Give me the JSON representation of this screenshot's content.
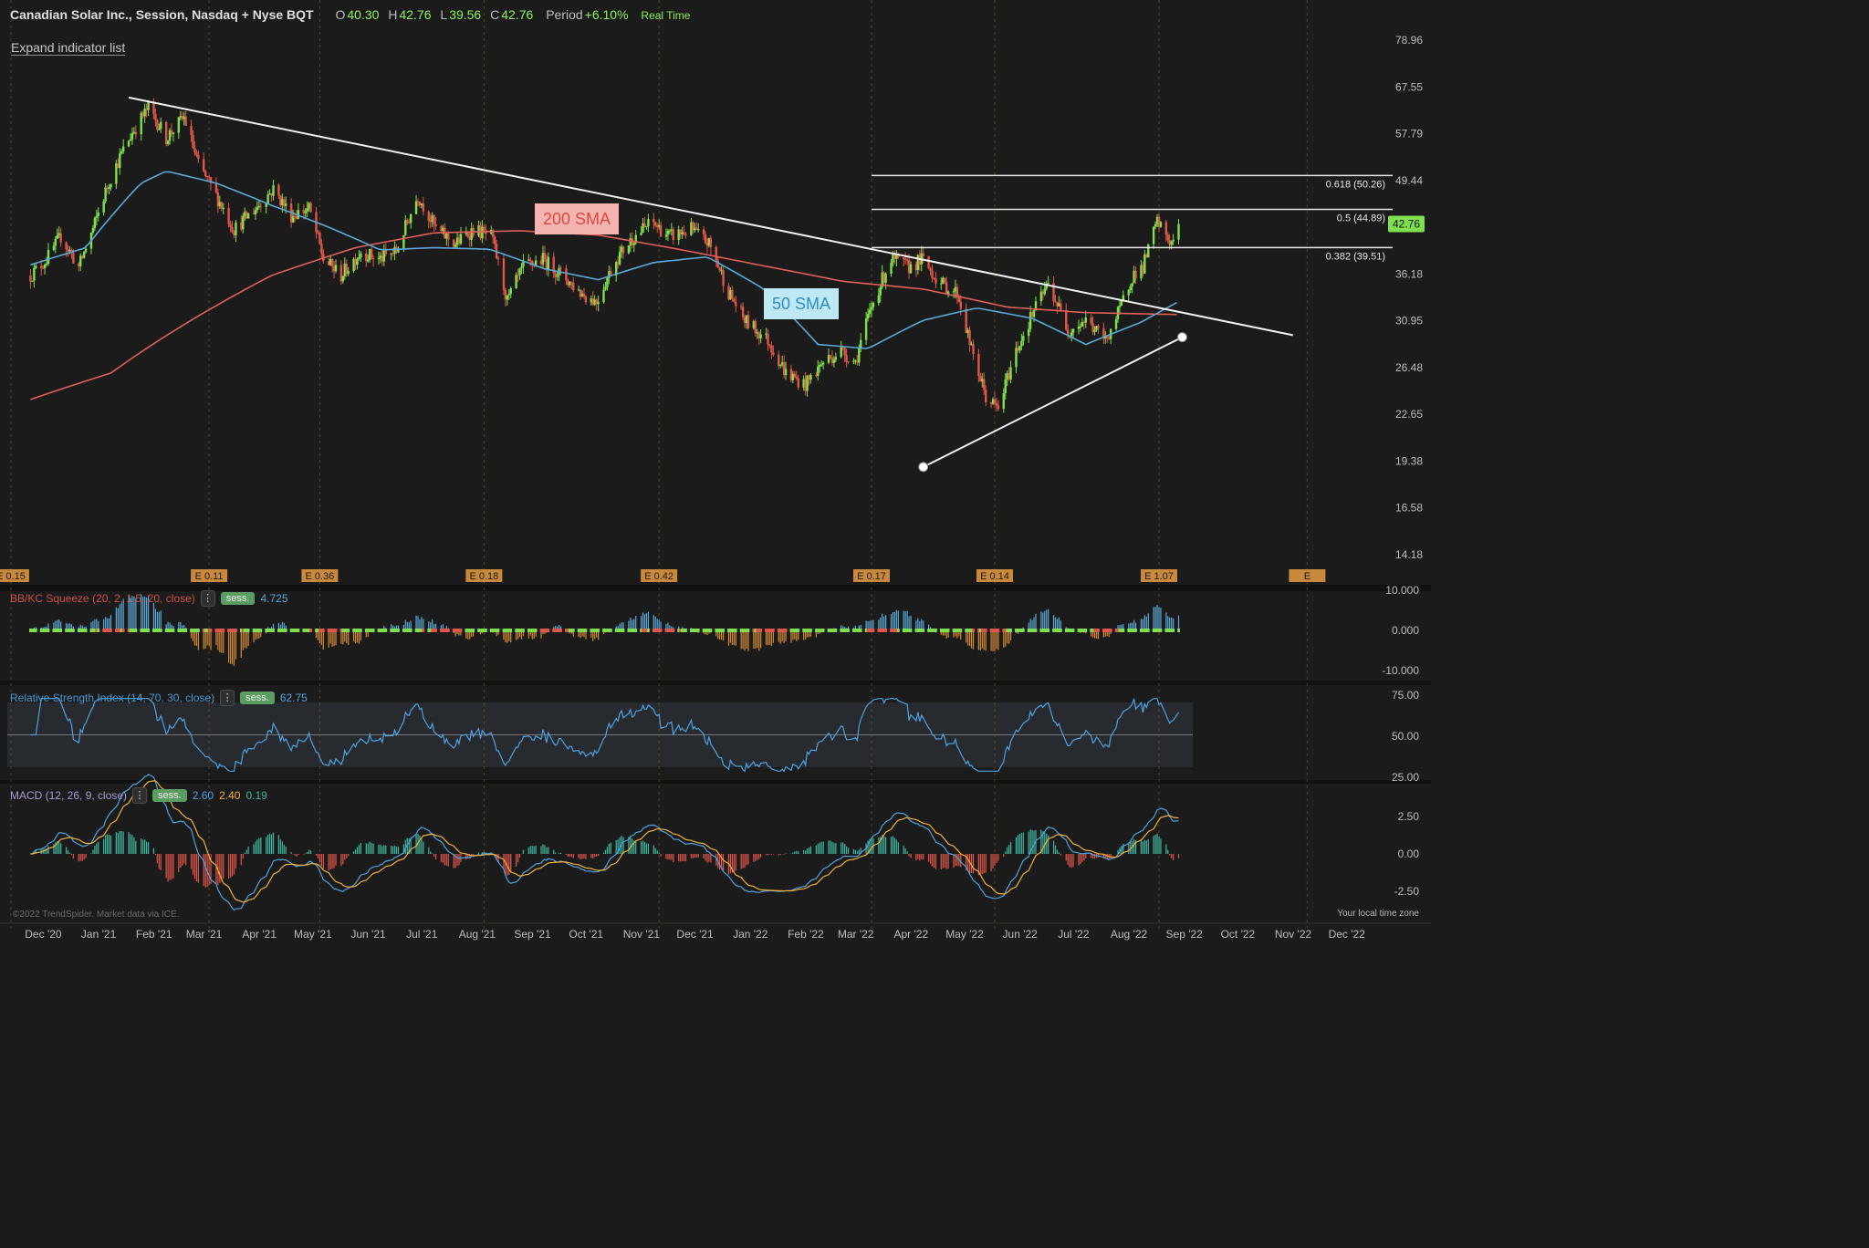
{
  "header": {
    "symbol": "Canadian Solar Inc., Session, Nasdaq + Nyse BQT",
    "open_label": "O",
    "open": "40.30",
    "high_label": "H",
    "high": "42.76",
    "low_label": "L",
    "low": "39.56",
    "close_label": "C",
    "close": "42.76",
    "period_label": "Period",
    "period": "+6.10%",
    "realtime": "Real Time"
  },
  "expand_label": "Expand indicator list",
  "colors": {
    "up": "#7ee04e",
    "down": "#e0564a",
    "sma200": "#e0605a",
    "sma50": "#5aa9d6",
    "trendline": "#f0f0f0",
    "rsi": "#4ea3e0",
    "macd": "#4ea3e0",
    "signal": "#f0b03c",
    "earnings": "#c8893c",
    "bg": "#1b1b1b"
  },
  "x_axis": {
    "labels": [
      "Dec '20",
      "Jan '21",
      "Feb '21",
      "Mar '21",
      "Apr '21",
      "May '21",
      "Jun '21",
      "Jul '21",
      "Aug '21",
      "Sep '21",
      "Oct '21",
      "Nov '21",
      "Dec '21",
      "Jan '22",
      "Feb '22",
      "Mar '22",
      "Apr '22",
      "May '22",
      "Jun '22",
      "Jul '22",
      "Aug '22",
      "Sep '22",
      "Oct '22",
      "Nov '22",
      "Dec '22"
    ]
  },
  "indicators": {
    "squeeze": {
      "name": "BB/KC Squeeze (20, 2, 1.5, 20, close)",
      "sess": "sess.",
      "value": "4.725",
      "ticks": [
        "10.000",
        "0.000",
        "-10.000"
      ]
    },
    "rsi": {
      "name": "Relative Strength Index (14, 70, 30, close)",
      "sess": "sess.",
      "value": "62.75",
      "ticks": [
        "75.00",
        "50.00",
        "25.00"
      ]
    },
    "macd": {
      "name": "MACD (12, 26, 9, close)",
      "sess": "sess.",
      "macd": "2.60",
      "signal": "2.40",
      "hist": "0.19",
      "ticks": [
        "2.50",
        "0.00",
        "-2.50"
      ]
    }
  },
  "footnote": "©2022 TrendSpider. Market data via ICE.",
  "timezone": "Your local time zone",
  "chart_data": {
    "type": "candlestick",
    "title": "Canadian Solar Inc., Session, Nasdaq + Nyse BQT",
    "y_scale": "log",
    "y_ticks": [
      "78.96",
      "67.55",
      "57.79",
      "49.44",
      "42.76",
      "36.18",
      "30.95",
      "26.48",
      "22.65",
      "19.38",
      "16.58",
      "14.18"
    ],
    "last_price": "42.76",
    "price_path": [
      [
        "2020-12-01",
        36
      ],
      [
        "2020-12-10",
        38
      ],
      [
        "2020-12-18",
        41
      ],
      [
        "2020-12-28",
        37
      ],
      [
        "2021-01-05",
        42
      ],
      [
        "2021-01-15",
        50
      ],
      [
        "2021-01-27",
        58
      ],
      [
        "2021-02-05",
        63
      ],
      [
        "2021-02-15",
        57
      ],
      [
        "2021-02-25",
        61
      ],
      [
        "2021-03-05",
        52
      ],
      [
        "2021-03-15",
        47
      ],
      [
        "2021-03-25",
        42
      ],
      [
        "2021-04-06",
        45
      ],
      [
        "2021-04-16",
        48
      ],
      [
        "2021-04-26",
        44
      ],
      [
        "2021-05-06",
        45
      ],
      [
        "2021-05-14",
        38
      ],
      [
        "2021-05-24",
        36
      ],
      [
        "2021-06-04",
        39
      ],
      [
        "2021-06-14",
        38
      ],
      [
        "2021-06-24",
        39
      ],
      [
        "2021-07-06",
        47
      ],
      [
        "2021-07-16",
        42
      ],
      [
        "2021-07-27",
        40
      ],
      [
        "2021-08-06",
        42
      ],
      [
        "2021-08-16",
        41
      ],
      [
        "2021-08-25",
        33
      ],
      [
        "2021-09-03",
        37
      ],
      [
        "2021-09-14",
        38
      ],
      [
        "2021-09-25",
        36
      ],
      [
        "2021-10-05",
        34
      ],
      [
        "2021-10-14",
        33
      ],
      [
        "2021-10-25",
        38
      ],
      [
        "2021-11-04",
        41
      ],
      [
        "2021-11-14",
        43
      ],
      [
        "2021-11-24",
        41
      ],
      [
        "2021-12-06",
        42
      ],
      [
        "2021-12-16",
        40
      ],
      [
        "2021-12-27",
        34
      ],
      [
        "2022-01-05",
        31
      ],
      [
        "2022-01-18",
        29
      ],
      [
        "2022-01-28",
        26
      ],
      [
        "2022-02-08",
        25
      ],
      [
        "2022-02-18",
        27
      ],
      [
        "2022-02-28",
        28
      ],
      [
        "2022-03-08",
        27
      ],
      [
        "2022-03-18",
        33
      ],
      [
        "2022-03-28",
        38
      ],
      [
        "2022-04-07",
        37
      ],
      [
        "2022-04-14",
        38
      ],
      [
        "2022-04-25",
        35
      ],
      [
        "2022-05-04",
        34
      ],
      [
        "2022-05-12",
        28
      ],
      [
        "2022-05-20",
        24
      ],
      [
        "2022-05-27",
        23
      ],
      [
        "2022-06-06",
        28
      ],
      [
        "2022-06-16",
        32
      ],
      [
        "2022-06-24",
        35
      ],
      [
        "2022-07-05",
        30
      ],
      [
        "2022-07-15",
        31
      ],
      [
        "2022-07-26",
        29
      ],
      [
        "2022-08-03",
        32
      ],
      [
        "2022-08-10",
        36
      ],
      [
        "2022-08-16",
        37
      ],
      [
        "2022-08-24",
        43
      ],
      [
        "2022-09-01",
        40
      ],
      [
        "2022-09-05",
        42.76
      ]
    ],
    "sma200_label": "200 SMA",
    "sma200_path": [
      [
        "2020-12-01",
        23.8
      ],
      [
        "2021-01-15",
        26
      ],
      [
        "2021-03-01",
        31
      ],
      [
        "2021-04-15",
        36
      ],
      [
        "2021-06-01",
        39.5
      ],
      [
        "2021-07-15",
        41.5
      ],
      [
        "2021-09-01",
        41.8
      ],
      [
        "2021-10-15",
        41.2
      ],
      [
        "2021-12-01",
        39.2
      ],
      [
        "2022-01-15",
        37.2
      ],
      [
        "2022-03-01",
        35.3
      ],
      [
        "2022-04-15",
        34.4
      ],
      [
        "2022-06-01",
        32.4
      ],
      [
        "2022-07-15",
        31.8
      ],
      [
        "2022-09-05",
        31.6
      ]
    ],
    "sma50_label": "50 SMA",
    "sma50_path": [
      [
        "2020-12-01",
        37.3
      ],
      [
        "2021-01-01",
        39.5
      ],
      [
        "2021-02-01",
        49
      ],
      [
        "2021-02-15",
        51
      ],
      [
        "2021-03-15",
        49
      ],
      [
        "2021-04-15",
        45.5
      ],
      [
        "2021-05-15",
        42.5
      ],
      [
        "2021-06-15",
        39.2
      ],
      [
        "2021-07-15",
        39.5
      ],
      [
        "2021-08-15",
        39.3
      ],
      [
        "2021-09-15",
        36.8
      ],
      [
        "2021-10-15",
        35.5
      ],
      [
        "2021-11-15",
        37.6
      ],
      [
        "2021-12-15",
        38.3
      ],
      [
        "2022-01-15",
        34.5
      ],
      [
        "2022-02-15",
        28.6
      ],
      [
        "2022-03-15",
        28.2
      ],
      [
        "2022-04-15",
        31
      ],
      [
        "2022-05-15",
        32.3
      ],
      [
        "2022-06-15",
        31.2
      ],
      [
        "2022-07-15",
        28.6
      ],
      [
        "2022-08-15",
        30.8
      ],
      [
        "2022-09-05",
        33
      ]
    ],
    "trendlines": [
      {
        "from": [
          "2021-01-25",
          65.2
        ],
        "to": [
          "2022-11-08",
          29.5
        ]
      },
      {
        "from": [
          "2022-04-15",
          19.0
        ],
        "to": [
          "2022-09-07",
          29.3
        ],
        "handles": true
      }
    ],
    "fib_levels": [
      {
        "label": "0.618 (50.26)",
        "value": 50.26,
        "from": "2022-03-17"
      },
      {
        "label": "0.5 (44.89)",
        "value": 44.89,
        "from": "2022-03-17"
      },
      {
        "label": "0.382 (39.51)",
        "value": 39.51,
        "from": "2022-03-17"
      }
    ],
    "earnings": [
      {
        "date": "2020-11-20",
        "label": "E 0.15"
      },
      {
        "date": "2021-03-11",
        "label": "E 0.11"
      },
      {
        "date": "2021-05-12",
        "label": "E 0.36"
      },
      {
        "date": "2021-08-12",
        "label": "E 0.18"
      },
      {
        "date": "2021-11-18",
        "label": "E 0.42"
      },
      {
        "date": "2022-03-17",
        "label": "E 0.17"
      },
      {
        "date": "2022-05-25",
        "label": "E 0.14"
      },
      {
        "date": "2022-08-25",
        "label": "E 1.07"
      },
      {
        "date": "2022-11-16",
        "label": "E"
      }
    ],
    "x_range": [
      "2020-11-18",
      "2023-01-10"
    ],
    "last_bar": "2022-09-05"
  }
}
